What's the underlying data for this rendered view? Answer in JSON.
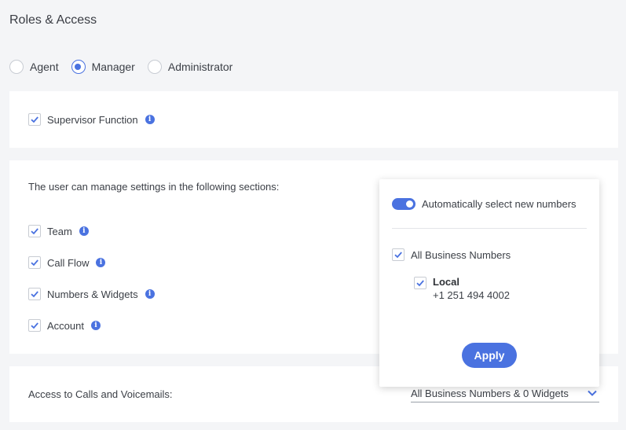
{
  "page": {
    "title": "Roles & Access"
  },
  "roles": [
    {
      "label": "Agent",
      "selected": false
    },
    {
      "label": "Manager",
      "selected": true
    },
    {
      "label": "Administrator",
      "selected": false
    }
  ],
  "supervisor": {
    "label": "Supervisor Function",
    "checked": true
  },
  "sections": {
    "intro": "The user can manage settings in the following sections:",
    "items": [
      {
        "label": "Team",
        "checked": true
      },
      {
        "label": "Call Flow",
        "checked": true
      },
      {
        "label": "Numbers & Widgets",
        "checked": true
      },
      {
        "label": "Account",
        "checked": true
      }
    ]
  },
  "popup": {
    "toggle_label": "Automatically select new numbers",
    "toggle_on": true,
    "all_label": "All Business Numbers",
    "number_name": "Local",
    "number_value": "+1 251 494 4002",
    "apply_label": "Apply"
  },
  "access": {
    "label": "Access to Calls and Voicemails:",
    "selected": "All Business Numbers & 0 Widgets"
  },
  "colors": {
    "accent": "#4a72e0",
    "background": "#f4f5f7"
  }
}
